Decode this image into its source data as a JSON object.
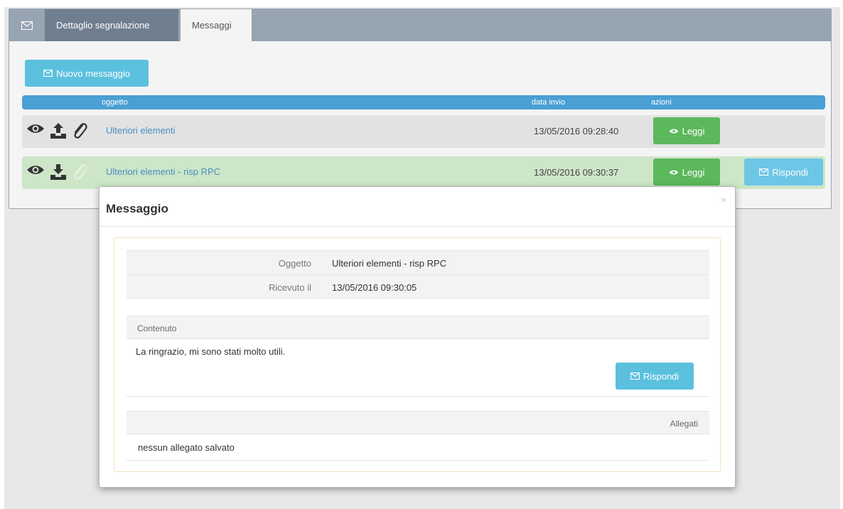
{
  "tabs": [
    {
      "label": "Dettaglio segnalazione",
      "active": false
    },
    {
      "label": "Messaggi",
      "active": true
    }
  ],
  "toolbar": {
    "new_message_label": "Nuovo messaggio"
  },
  "table": {
    "headers": {
      "subject": "oggetto",
      "sent_date": "data invio",
      "actions": "azioni"
    },
    "rows": [
      {
        "subject": "Ulteriori elementi",
        "date": "13/05/2016 09:28:40",
        "read_label": "Leggi",
        "reply_label": ""
      },
      {
        "subject": "Ulteriori elementi - risp RPC",
        "date": "13/05/2016 09:30:37",
        "read_label": "Leggi",
        "reply_label": "Rispondi"
      }
    ]
  },
  "modal": {
    "title": "Messaggio",
    "close": "×",
    "fields": [
      {
        "label": "Oggetto",
        "value": "Ulteriori elementi - risp RPC"
      },
      {
        "label": "Ricevuto il",
        "value": "13/05/2016 09:30:05"
      }
    ],
    "content_header": "Contenuto",
    "content_text": "La ringrazio, mi sono stati molto utili.",
    "reply_label": "Rispondi",
    "attachments_header": "Allegati",
    "attachments_text": "nessun allegato salvato"
  },
  "colors": {
    "tabbar": "#97a4b1",
    "active_tab": "#6f7f8f",
    "table_header": "#4a9fd4",
    "link": "#4a8fc4",
    "info_button": "#5bc0de",
    "success_button": "#5cb85c",
    "selected_row": "#cde6c8"
  }
}
